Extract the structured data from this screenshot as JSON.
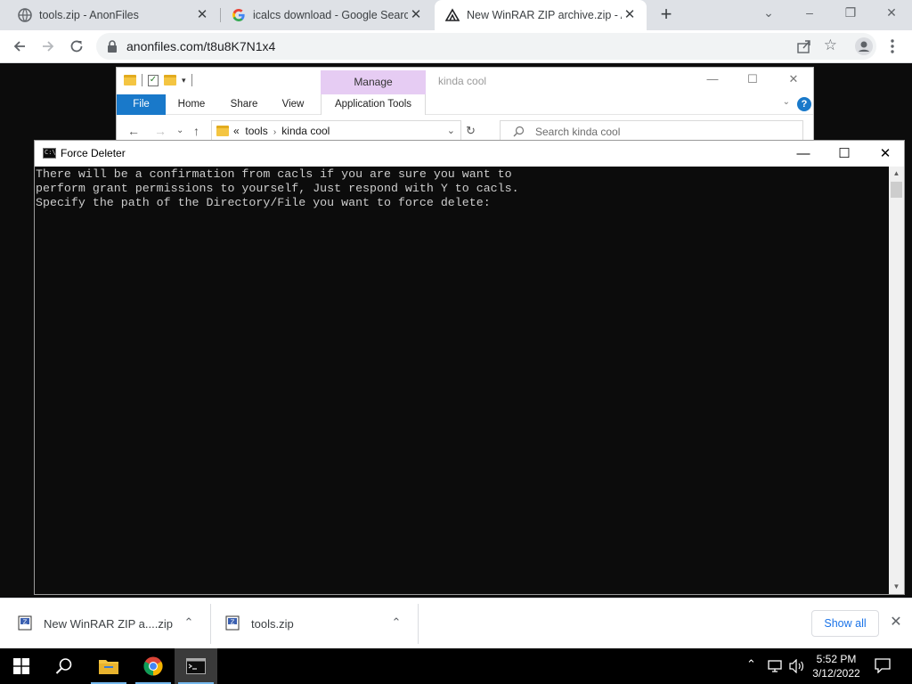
{
  "browser": {
    "tabs": [
      {
        "title": "tools.zip - AnonFiles",
        "favicon": "globe-icon"
      },
      {
        "title": "icalcs download - Google Search",
        "favicon": "google-icon"
      },
      {
        "title": "New WinRAR ZIP archive.zip - Ar",
        "favicon": "anonfiles-icon"
      }
    ],
    "url": "anonfiles.com/t8u8K7N1x4"
  },
  "explorer": {
    "manage_label": "Manage",
    "title": "kinda cool",
    "ribbon_tabs": [
      "File",
      "Home",
      "Share",
      "View",
      "Application Tools"
    ],
    "breadcrumb_prefix": "«",
    "breadcrumb": [
      "tools",
      "kinda cool"
    ],
    "search_placeholder": "Search kinda cool"
  },
  "console": {
    "title": "Force Deleter",
    "lines": [
      "There will be a confirmation from cacls if you are sure you want to",
      "perform grant permissions to yourself, Just respond with Y to cacls.",
      "Specify the path of the Directory/File you want to force delete:"
    ]
  },
  "downloads": {
    "items": [
      {
        "name": "New WinRAR ZIP a....zip"
      },
      {
        "name": "tools.zip"
      }
    ],
    "show_all_label": "Show all"
  },
  "taskbar": {
    "time": "5:52 PM",
    "date": "3/12/2022"
  },
  "colors": {
    "console_bg": "#0c0c0c",
    "console_text": "#cccccc",
    "manage_tab": "#e6ccf3",
    "file_tab": "#1979ca",
    "accent": "#1a73e8"
  }
}
